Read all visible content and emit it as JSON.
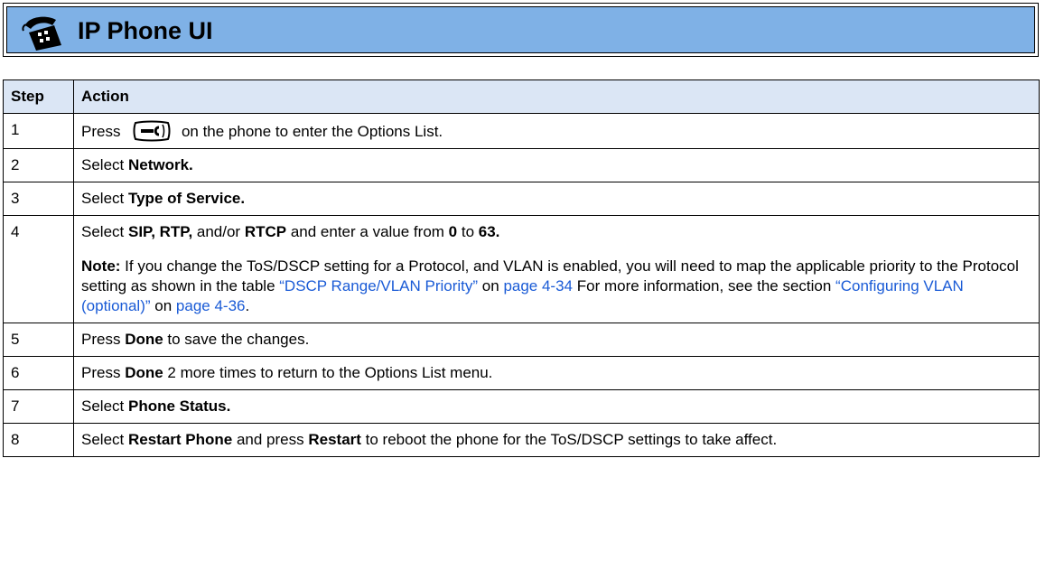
{
  "header": {
    "title": "IP Phone UI",
    "icon": "phone-icon",
    "background_color": "#7fb1e6"
  },
  "table": {
    "columns": [
      "Step",
      "Action"
    ],
    "header_background": "#dbe6f5",
    "rows": [
      {
        "step": "1",
        "action_prefix": "Press",
        "action_icon": "options-key-icon",
        "action_suffix": "on the phone to enter the Options List."
      },
      {
        "step": "2",
        "action_prefix": "Select ",
        "action_bold": "Network."
      },
      {
        "step": "3",
        "action_prefix": "Select ",
        "action_bold": "Type of Service."
      },
      {
        "step": "4",
        "line1": {
          "t1": "Select ",
          "b1": "SIP, RTP,",
          "t2": " and/or ",
          "b2": "RTCP",
          "t3": " and enter a value from ",
          "b3": "0",
          "t4": " to ",
          "b4": "63."
        },
        "note": {
          "label": "Note:",
          "text1": " If you change the ToS/DSCP setting for a Protocol, and VLAN is enabled, you will need to map the applicable priority to the Protocol setting as shown in the table ",
          "link1": "“DSCP Range/VLAN Priority”",
          "text2": " on ",
          "link2": "page 4-34",
          "text3": " For more information, see the section ",
          "link3": "“Configuring VLAN (optional)”",
          "text4": " on ",
          "link4": "page 4-36",
          "text5": "."
        }
      },
      {
        "step": "5",
        "action_prefix": "Press ",
        "action_bold": "Done",
        "action_suffix": " to save the changes."
      },
      {
        "step": "6",
        "action_prefix": "Press ",
        "action_bold": "Done",
        "action_suffix": " 2 more times to return to the Options List menu."
      },
      {
        "step": "7",
        "action_prefix": "Select ",
        "action_bold": "Phone Status."
      },
      {
        "step": "8",
        "t1": "Select ",
        "b1": "Restart Phone",
        "t2": " and press ",
        "b2": "Restart",
        "t3": " to reboot the phone for the ToS/DSCP settings to take affect."
      }
    ]
  },
  "colors": {
    "link": "#1a5bd6",
    "border": "#000000"
  }
}
